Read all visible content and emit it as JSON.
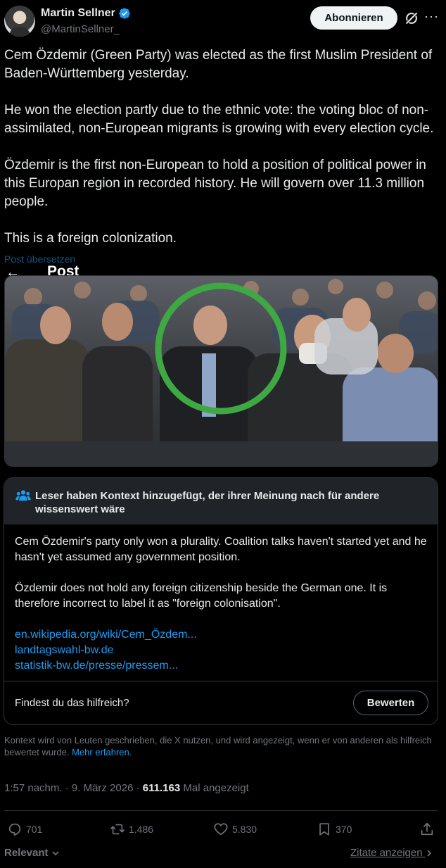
{
  "header": {
    "name": "Martin Sellner",
    "handle": "@MartinSellner_",
    "subscribe_label": "Abonnieren",
    "more_label": "···"
  },
  "tweet": {
    "paragraphs": [
      "Cem Özdemir (Green Party) was elected as the first Muslim President of Baden-Württemberg yesterday.",
      "He won the election partly due to the ethnic vote: the voting bloc of non-assimilated, non-European migrants is growing with every election cycle.",
      "Özdemir is the first non-European to hold a position of political power in this Europan region in recorded history. He will govern over 11.3 million people.",
      "This is a  foreign colonization."
    ],
    "translate_label": "Post übersetzen"
  },
  "overlay": {
    "back_arrow": "←",
    "title": "Post"
  },
  "community_note": {
    "title": "Leser haben Kontext hinzugefügt, der ihrer Meinung nach für andere wissenswert wäre",
    "paragraphs": [
      "Cem Özdemir's party only won a plurality. Coalition talks haven't started yet and he hasn't yet assumed any government position.",
      "Özdemir does not hold any foreign citizenship beside the German one. It is therefore incorrect to label it as \"foreign colonisation\"."
    ],
    "links": [
      "en.wikipedia.org/wiki/Cem_Özdem...",
      "landtagswahl-bw.de",
      "statistik-bw.de/presse/pressem..."
    ],
    "helpful_question": "Findest du das hilfreich?",
    "rate_label": "Bewerten"
  },
  "context_info": {
    "text": "Kontext wird von Leuten geschrieben, die X nutzen, und wird angezeigt, wenn er von anderen als hilfreich bewertet wurde. ",
    "link": "Mehr erfahren",
    "end": "."
  },
  "meta": {
    "time": "1:57 nachm.",
    "separator": " · ",
    "date": "9. März 2026",
    "views": "611.163",
    "views_label": " Mal angezeigt"
  },
  "actions": {
    "replies": "701",
    "reposts": "1.486",
    "likes": "5.830",
    "bookmarks": "370"
  },
  "footer": {
    "relevant_label": "Relevant",
    "quotes_label": "Zitate anzeigen"
  },
  "colors": {
    "accent": "#1d9bf0",
    "background": "#000000",
    "note_header": "#202327",
    "muted": "#71767b",
    "verified": "#1d9bf0",
    "highlight_circle": "#3fa843"
  }
}
